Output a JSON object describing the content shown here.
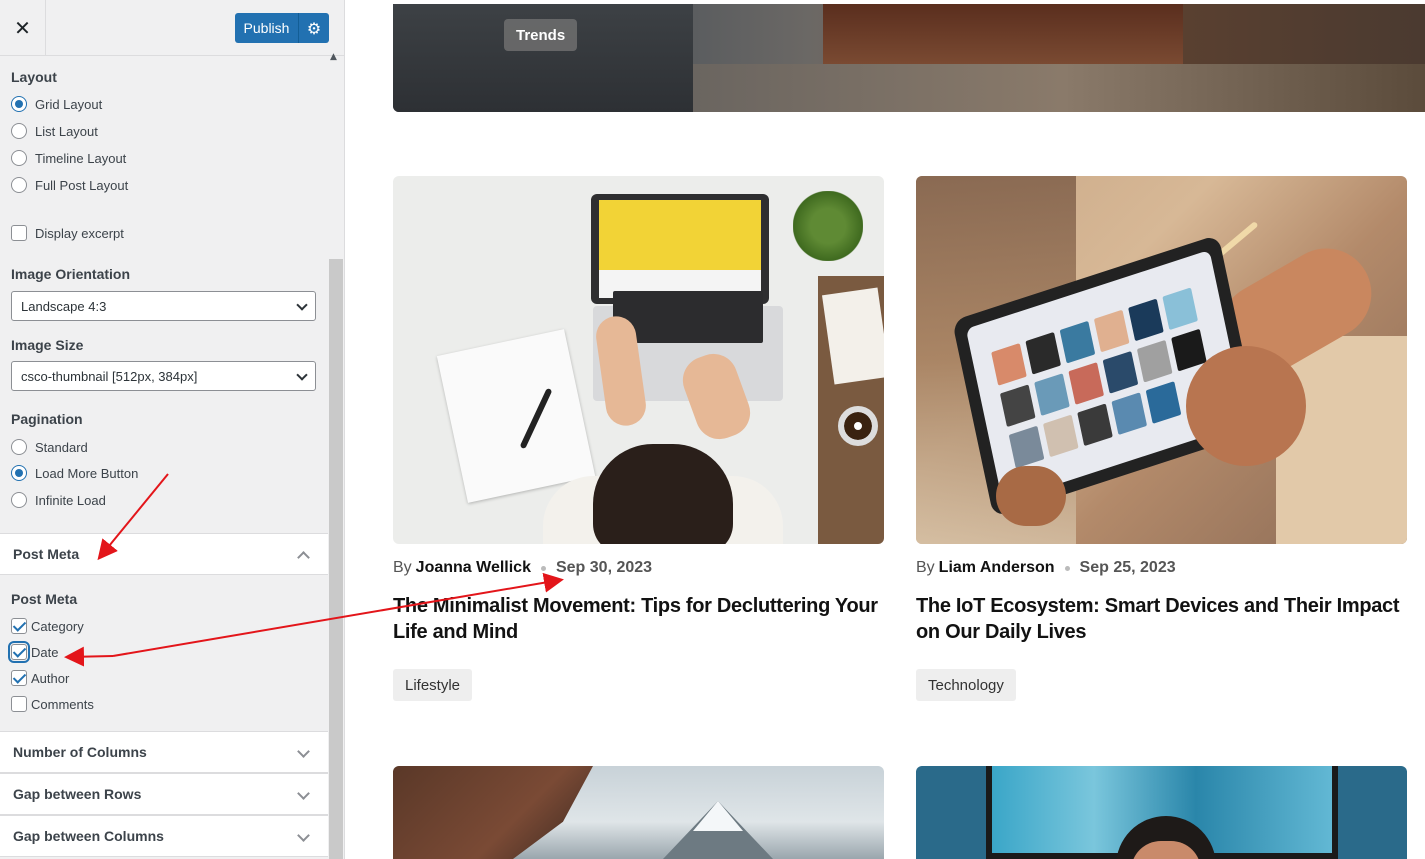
{
  "topbar": {
    "close_icon": "close-icon",
    "publish_label": "Publish",
    "publish_settings_icon": "gear-icon"
  },
  "layout": {
    "label": "Layout",
    "options": [
      "Grid Layout",
      "List Layout",
      "Timeline Layout",
      "Full Post Layout"
    ],
    "selected": "Grid Layout"
  },
  "display_excerpt": {
    "label": "Display excerpt",
    "checked": false
  },
  "image_orientation": {
    "label": "Image Orientation",
    "value": "Landscape 4:3"
  },
  "image_size": {
    "label": "Image Size",
    "value": "csco-thumbnail [512px, 384px]"
  },
  "pagination": {
    "label": "Pagination",
    "options": [
      "Standard",
      "Load More Button",
      "Infinite Load"
    ],
    "selected": "Load More Button"
  },
  "post_meta_section": {
    "title": "Post Meta",
    "expanded": true
  },
  "post_meta": {
    "label": "Post Meta",
    "options": [
      {
        "label": "Category",
        "checked": true
      },
      {
        "label": "Date",
        "checked": true
      },
      {
        "label": "Author",
        "checked": true
      },
      {
        "label": "Comments",
        "checked": false
      }
    ]
  },
  "collapsed_sections": [
    "Number of Columns",
    "Gap between Rows",
    "Gap between Columns"
  ],
  "hero": {
    "badge": "Trends"
  },
  "posts": [
    {
      "by": "By",
      "author": "Joanna Wellick",
      "date": "Sep 30, 2023",
      "title": "The Minimalist Movement: Tips for Decluttering Your Life and Mind",
      "tag": "Lifestyle"
    },
    {
      "by": "By",
      "author": "Liam Anderson",
      "date": "Sep 25, 2023",
      "title": "The IoT Ecosystem: Smart Devices and Their Impact on Our Daily Lives",
      "tag": "Technology"
    }
  ],
  "colors": {
    "accent": "#2271b1",
    "annotation_arrow": "#e3151a"
  }
}
